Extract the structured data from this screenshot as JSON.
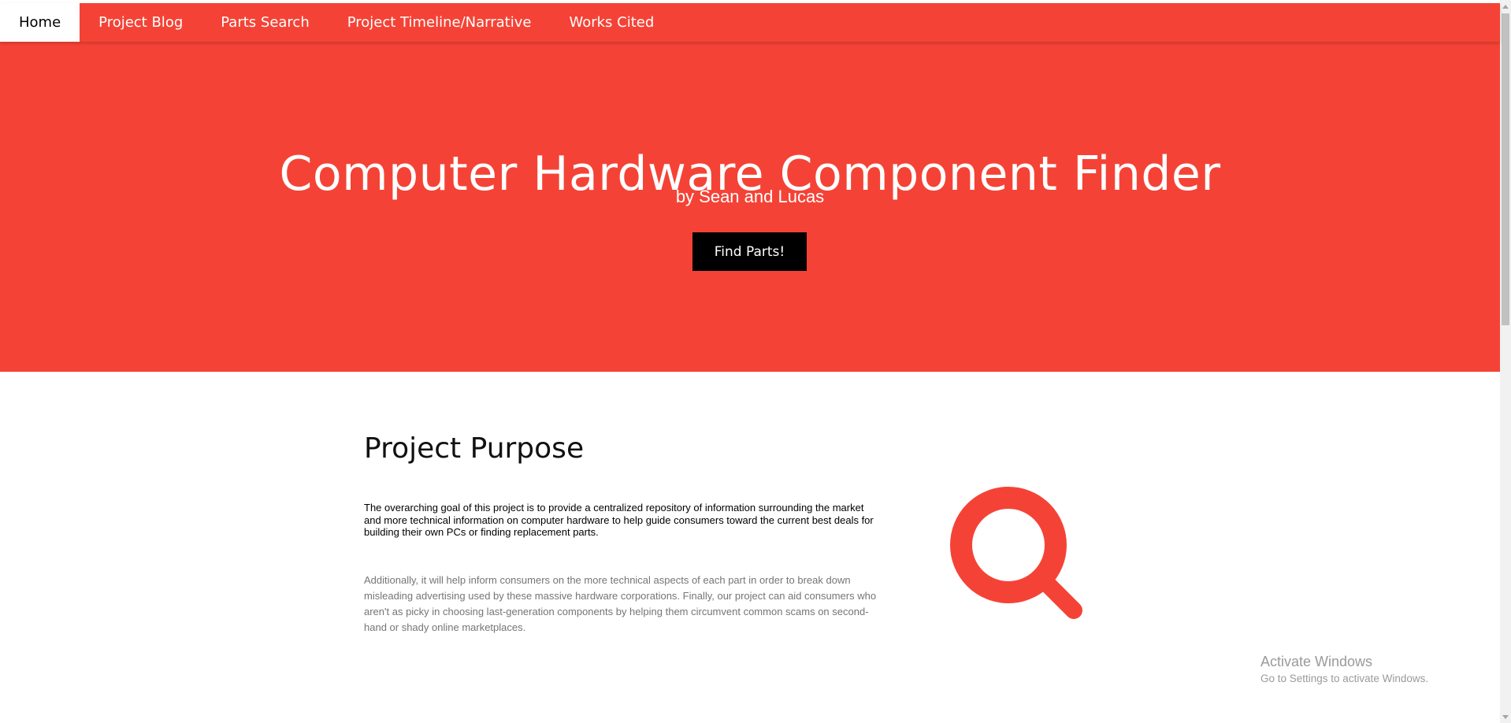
{
  "nav": {
    "items": [
      {
        "label": "Home",
        "active": true
      },
      {
        "label": "Project Blog",
        "active": false
      },
      {
        "label": "Parts Search",
        "active": false
      },
      {
        "label": "Project Timeline/Narrative",
        "active": false
      },
      {
        "label": "Works Cited",
        "active": false
      }
    ]
  },
  "hero": {
    "title": "Computer Hardware Component Finder",
    "subtitle": "by Sean and Lucas",
    "button_label": "Find Parts!"
  },
  "purpose": {
    "title": "Project Purpose",
    "paragraph1": "The overarching goal of this project is to provide a centralized repository of information surrounding the market and more technical information on computer hardware to help guide consumers toward the current best deals for building their own PCs or finding replacement parts.",
    "paragraph2": "Additionally, it will help inform consumers on the more technical aspects of each part in order to break down misleading advertising used by these massive hardware corporations. Finally, our project can aid consumers who aren't as picky in choosing last-generation components by helping them circumvent common scams on second-hand or shady online marketplaces.",
    "icon": "search-icon"
  },
  "watermark": {
    "title": "Activate Windows",
    "subtitle": "Go to Settings to activate Windows."
  },
  "colors": {
    "brand_red": "#f44336",
    "button_black": "#000000",
    "text_gray": "#757575"
  }
}
